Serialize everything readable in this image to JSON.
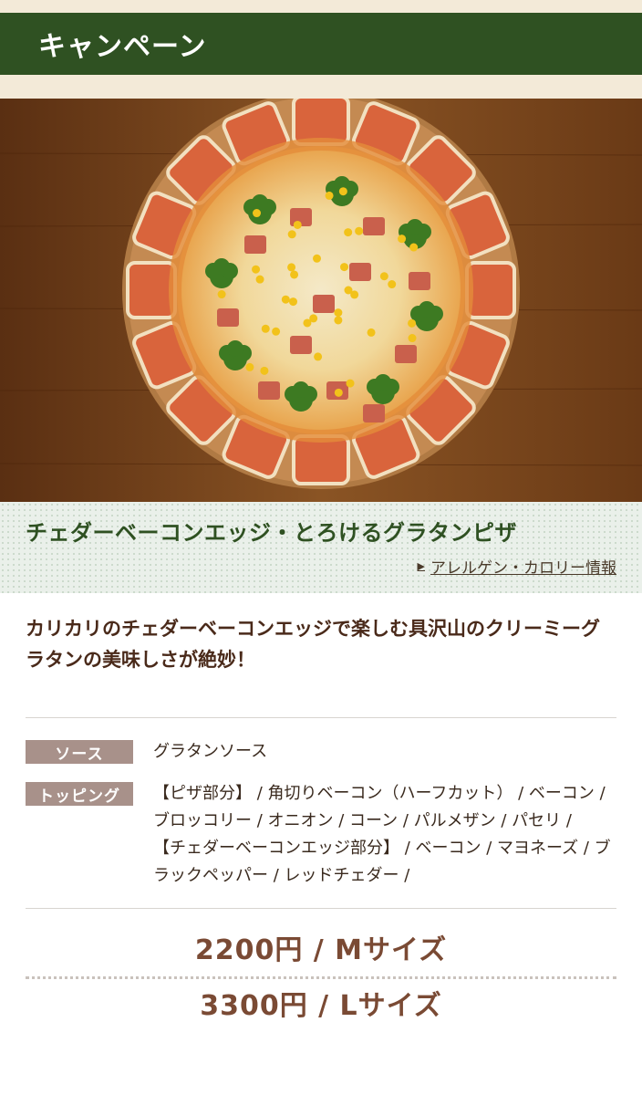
{
  "header": {
    "title": "キャンペーン"
  },
  "hero": {
    "image_alt": "pizza-photo"
  },
  "product": {
    "title": "チェダーベーコンエッジ・とろけるグラタンピザ",
    "allergen_link": "アレルゲン・カロリー情報",
    "lead": "カリカリのチェダーベーコンエッジで楽しむ具沢山のクリーミーグラタンの美味しさが絶妙！"
  },
  "spec": {
    "sauce_label": "ソース",
    "sauce_value": "グラタンソース",
    "topping_label": "トッピング",
    "topping_line1": "【ピザ部分】 / 角切りベーコン（ハーフカット） / ベーコン / ブロッコリー / オニオン / コーン / パルメザン / パセリ /",
    "topping_line2": "【チェダーベーコンエッジ部分】 / ベーコン / マヨネーズ / ブラックペッパー / レッドチェダー /"
  },
  "prices": {
    "m": "2200円 / Mサイズ",
    "l": "3300円 / Lサイズ"
  },
  "colors": {
    "header_green": "#2f5122",
    "title_green": "#2f5122",
    "price_brown": "#7a4a34",
    "label_bg": "#a8918a"
  }
}
